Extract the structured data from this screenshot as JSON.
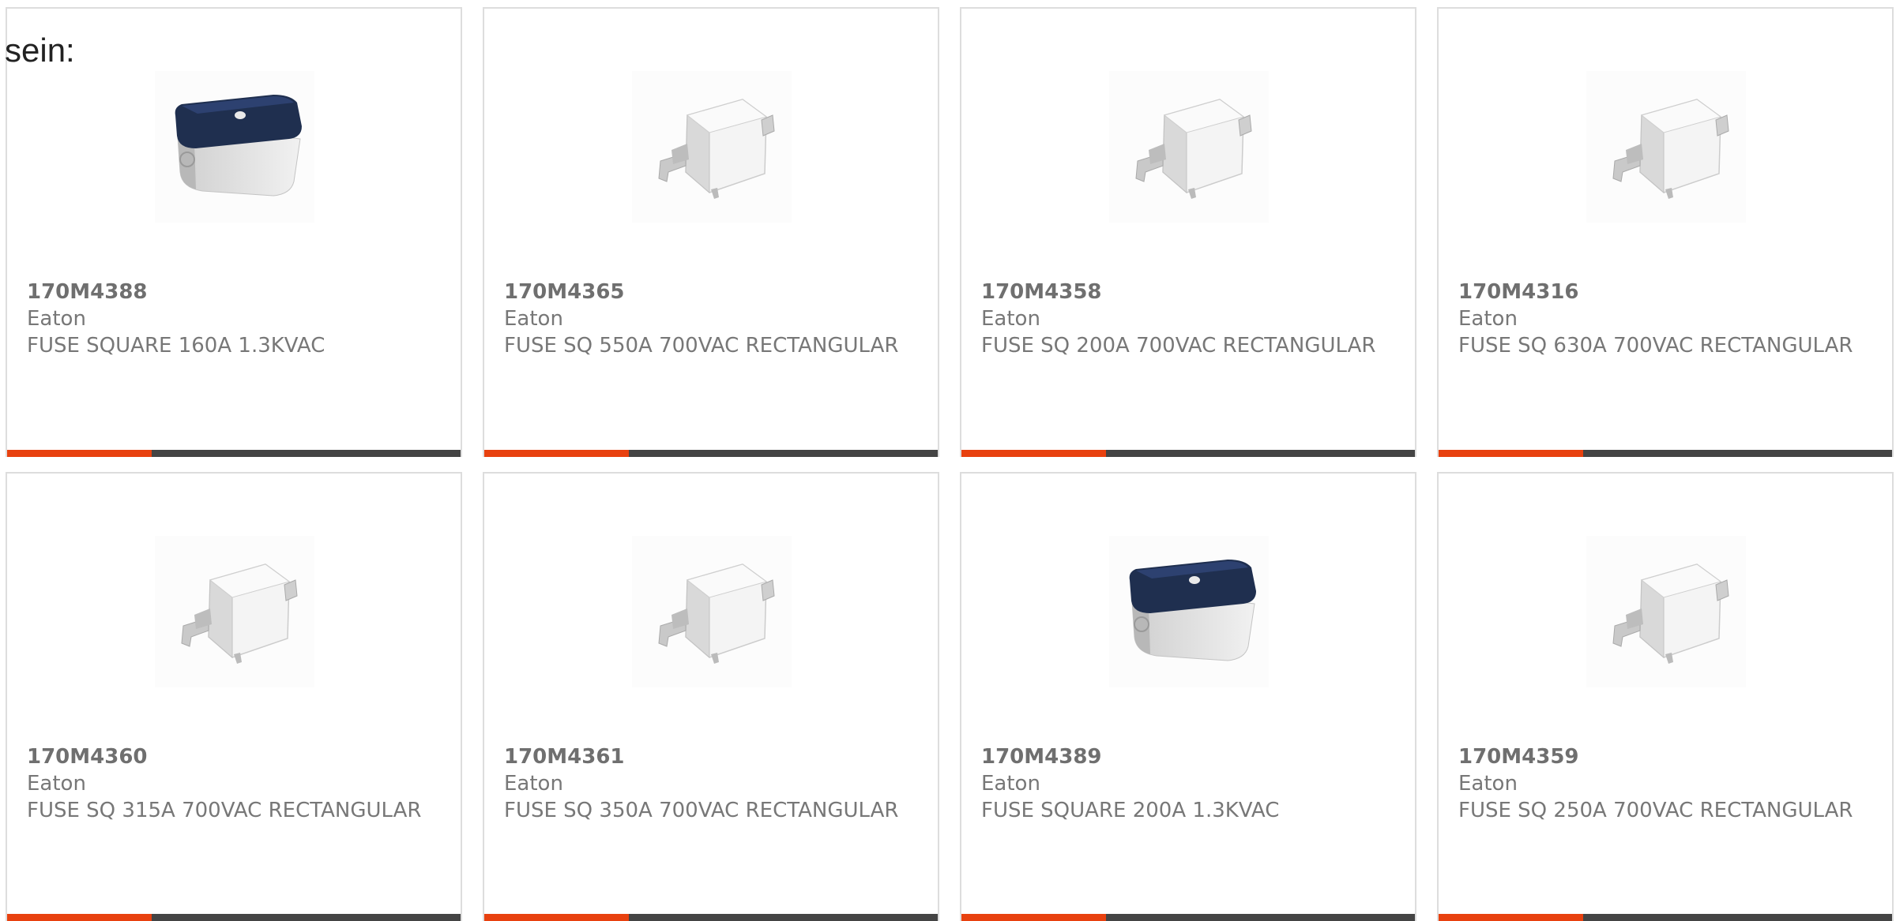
{
  "intro_text": "sein:",
  "colors": {
    "accent": "#e8410f",
    "bar_dark": "#444444",
    "text": "#777777",
    "border": "#dddddd",
    "fuse_cap_blue": "#1f2f4f"
  },
  "products": [
    {
      "part": "170M4388",
      "manufacturer": "Eaton",
      "description": "FUSE SQUARE 160A 1.3KVAC",
      "image": "fuse-square-blue-top-icon"
    },
    {
      "part": "170M4365",
      "manufacturer": "Eaton",
      "description": "FUSE SQ 550A 700VAC RECTANGULAR",
      "image": "fuse-rectangular-white-icon"
    },
    {
      "part": "170M4358",
      "manufacturer": "Eaton",
      "description": "FUSE SQ 200A 700VAC RECTANGULAR",
      "image": "fuse-rectangular-white-icon"
    },
    {
      "part": "170M4316",
      "manufacturer": "Eaton",
      "description": "FUSE SQ 630A 700VAC RECTANGULAR",
      "image": "fuse-rectangular-white-icon"
    },
    {
      "part": "170M4360",
      "manufacturer": "Eaton",
      "description": "FUSE SQ 315A 700VAC RECTANGULAR",
      "image": "fuse-rectangular-white-icon"
    },
    {
      "part": "170M4361",
      "manufacturer": "Eaton",
      "description": "FUSE SQ 350A 700VAC RECTANGULAR",
      "image": "fuse-rectangular-white-icon"
    },
    {
      "part": "170M4389",
      "manufacturer": "Eaton",
      "description": "FUSE SQUARE 200A 1.3KVAC",
      "image": "fuse-square-blue-top-icon"
    },
    {
      "part": "170M4359",
      "manufacturer": "Eaton",
      "description": "FUSE SQ 250A 700VAC RECTANGULAR",
      "image": "fuse-rectangular-white-icon"
    }
  ]
}
